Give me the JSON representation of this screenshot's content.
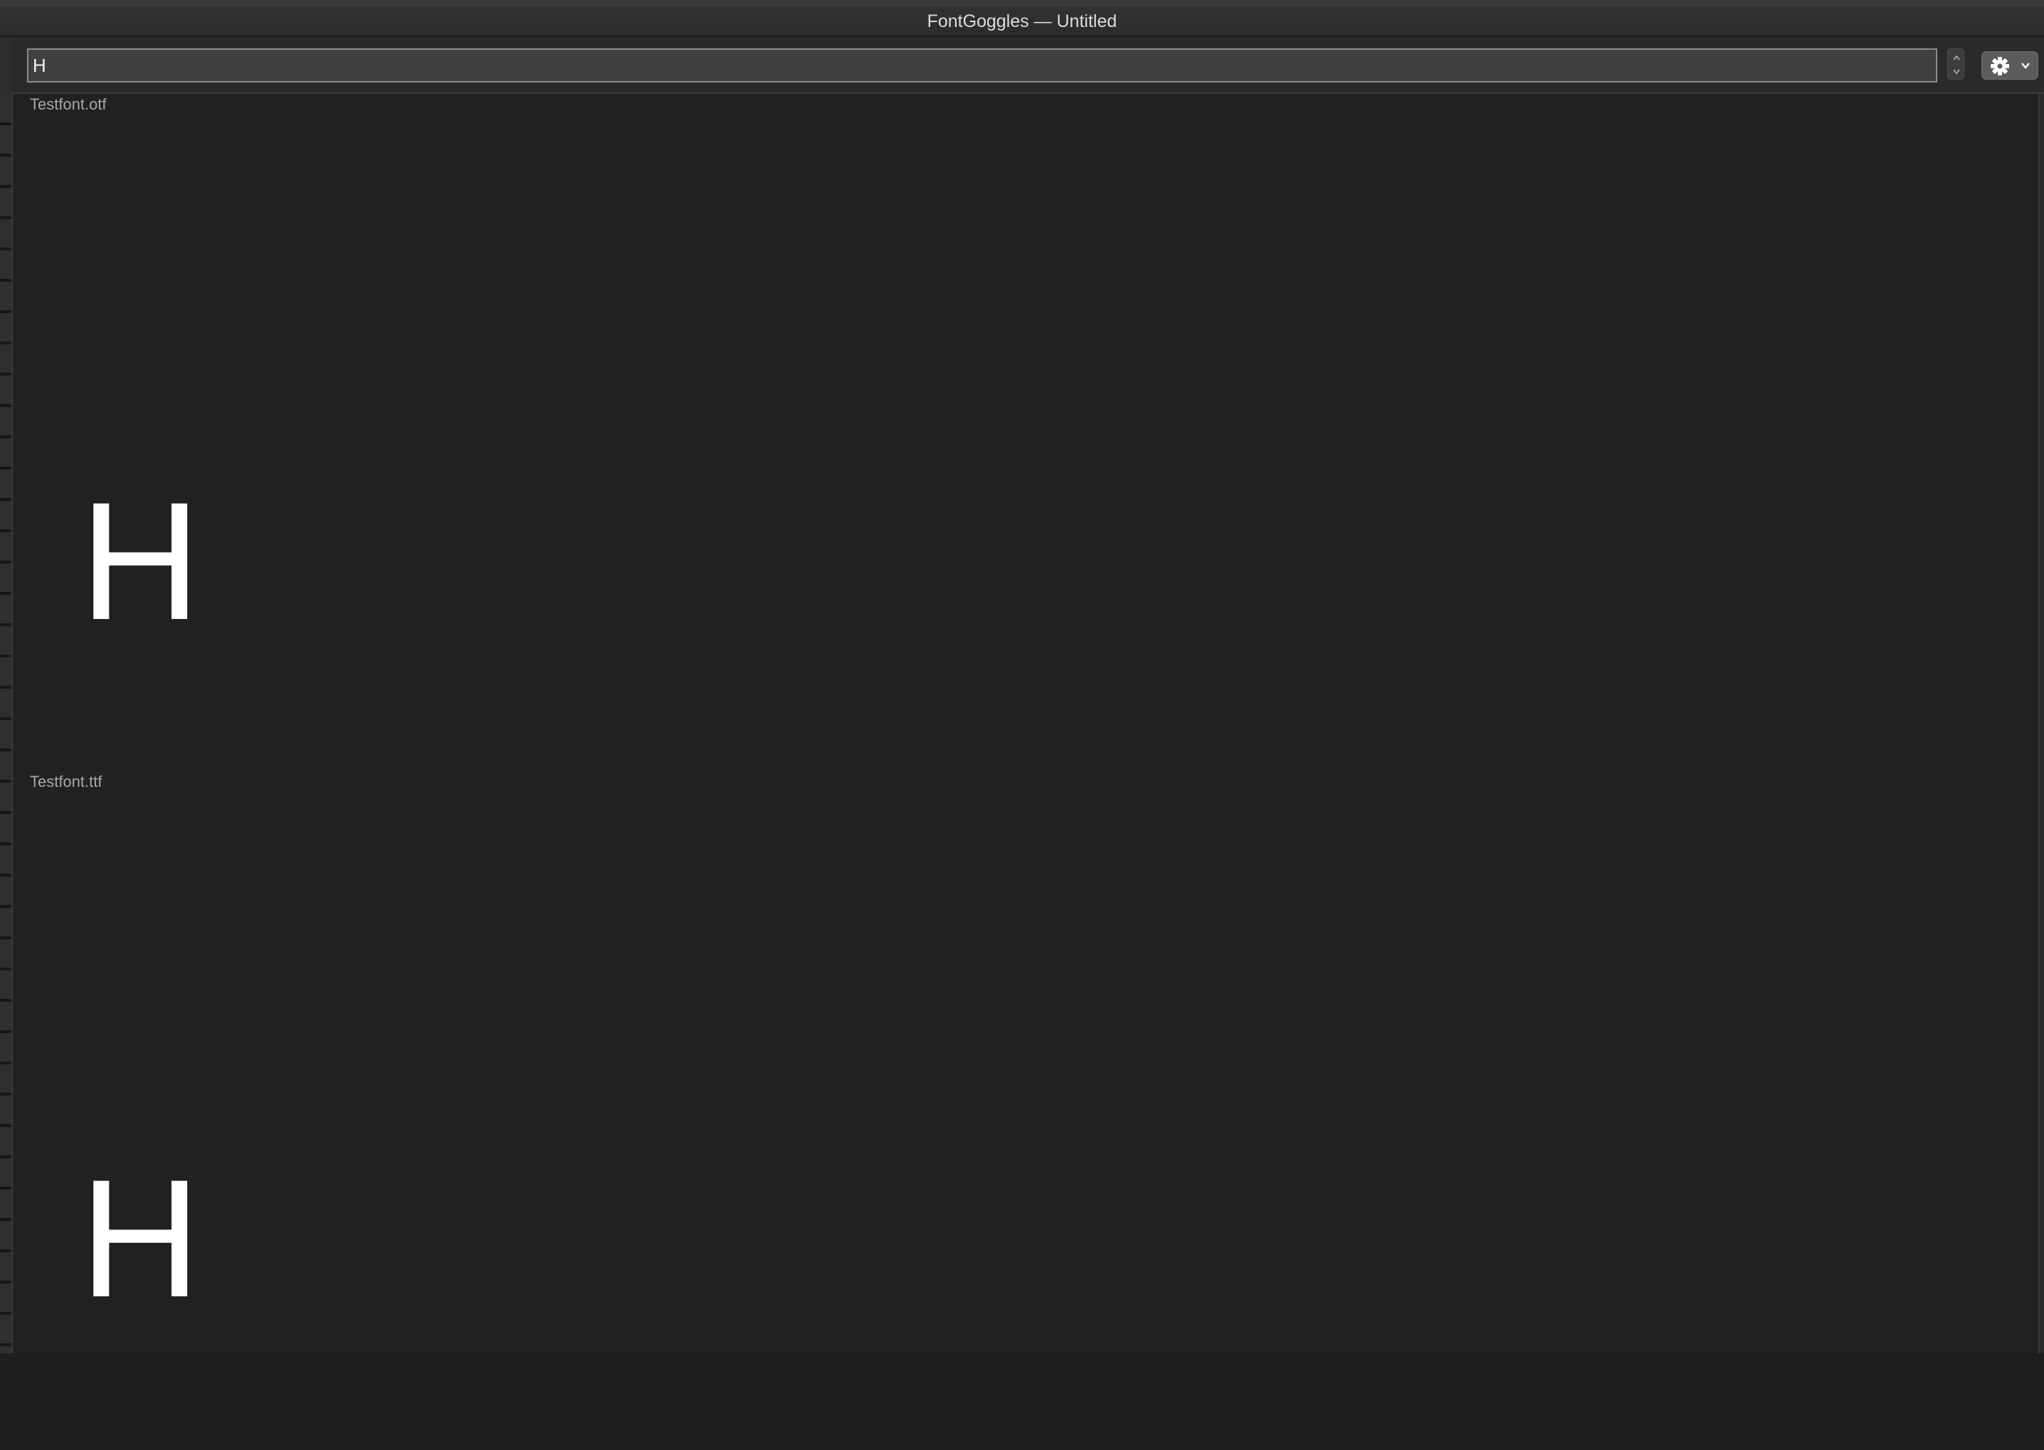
{
  "window": {
    "title": "FontGoggles — Untitled"
  },
  "toolbar": {
    "text_value": "H",
    "text_placeholder": "",
    "stepper_icon": "stepper-up-down-icon",
    "settings_icon": "gear-icon",
    "settings_menu_icon": "chevron-down-icon"
  },
  "fonts": [
    {
      "filename": "Testfont.otf",
      "sample_text": "H"
    },
    {
      "filename": "Testfont.ttf",
      "sample_text": "H"
    }
  ],
  "colors": {
    "background": "#212121",
    "glyph": "#ffffff",
    "label": "#a8a8a8"
  }
}
